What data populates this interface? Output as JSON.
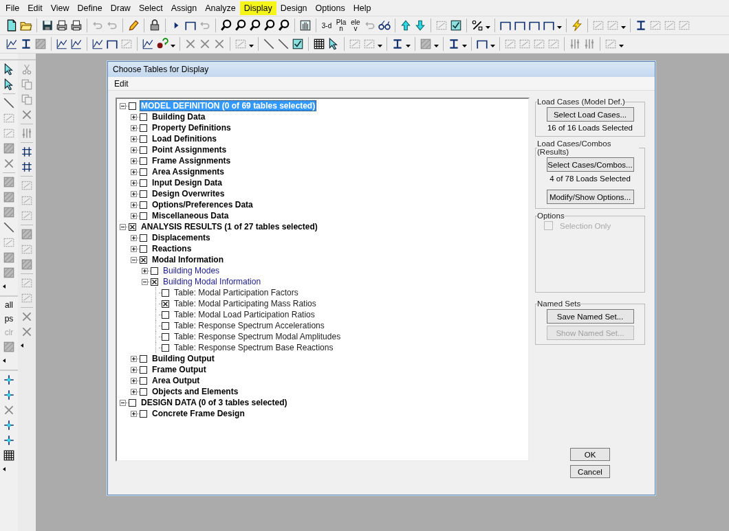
{
  "menu": [
    {
      "label": "File",
      "selected": false
    },
    {
      "label": "Edit",
      "selected": false
    },
    {
      "label": "View",
      "selected": false
    },
    {
      "label": "Define",
      "selected": false
    },
    {
      "label": "Draw",
      "selected": false
    },
    {
      "label": "Select",
      "selected": false
    },
    {
      "label": "Assign",
      "selected": false
    },
    {
      "label": "Analyze",
      "selected": false
    },
    {
      "label": "Display",
      "selected": true
    },
    {
      "label": "Design",
      "selected": false
    },
    {
      "label": "Options",
      "selected": false
    },
    {
      "label": "Help",
      "selected": false
    }
  ],
  "toolbar_labels": [
    "3-d",
    "Plan",
    "elev"
  ],
  "left_tool_labels": [
    {
      "label": "all",
      "disabled": false
    },
    {
      "label": "ps",
      "disabled": false
    },
    {
      "label": "clr",
      "disabled": true
    }
  ],
  "dialog": {
    "title": "Choose Tables for Display",
    "menu": [
      "Edit"
    ],
    "tree": [
      {
        "kind": "header",
        "label": "MODEL DEFINITION  (0 of 69 tables selected)",
        "checked": false,
        "expanded": true,
        "selected": true,
        "children": [
          {
            "kind": "group",
            "label": "Building Data",
            "checked": false,
            "expanded": false,
            "selected": false
          },
          {
            "kind": "group",
            "label": "Property Definitions",
            "checked": false,
            "expanded": false,
            "selected": false
          },
          {
            "kind": "group",
            "label": "Load Definitions",
            "checked": false,
            "expanded": false,
            "selected": false
          },
          {
            "kind": "group",
            "label": "Point Assignments",
            "checked": false,
            "expanded": false,
            "selected": false
          },
          {
            "kind": "group",
            "label": "Frame Assignments",
            "checked": false,
            "expanded": false,
            "selected": false
          },
          {
            "kind": "group",
            "label": "Area Assignments",
            "checked": false,
            "expanded": false,
            "selected": false
          },
          {
            "kind": "group",
            "label": "Input Design Data",
            "checked": false,
            "expanded": false,
            "selected": false
          },
          {
            "kind": "group",
            "label": "Design Overwrites",
            "checked": false,
            "expanded": false,
            "selected": false
          },
          {
            "kind": "group",
            "label": "Options/Preferences Data",
            "checked": false,
            "expanded": false,
            "selected": false
          },
          {
            "kind": "group",
            "label": "Miscellaneous Data",
            "checked": false,
            "expanded": false,
            "selected": false
          }
        ]
      },
      {
        "kind": "header",
        "label": "ANALYSIS RESULTS  (1 of 27 tables selected)",
        "checked": true,
        "expanded": true,
        "selected": false,
        "children": [
          {
            "kind": "group",
            "label": "Displacements",
            "checked": false,
            "expanded": false,
            "selected": false
          },
          {
            "kind": "group",
            "label": "Reactions",
            "checked": false,
            "expanded": false,
            "selected": false
          },
          {
            "kind": "group",
            "label": "Modal Information",
            "checked": true,
            "expanded": true,
            "selected": false,
            "children": [
              {
                "kind": "subgroup",
                "label": "Building Modes",
                "checked": false,
                "expanded": false,
                "selected": false
              },
              {
                "kind": "subgroup",
                "label": "Building Modal Information",
                "checked": true,
                "expanded": true,
                "selected": false,
                "children": [
                  {
                    "kind": "table",
                    "label": "Table:  Modal Participation Factors",
                    "checked": false,
                    "selected": false
                  },
                  {
                    "kind": "table",
                    "label": "Table:  Modal Participating Mass Ratios",
                    "checked": true,
                    "selected": false
                  },
                  {
                    "kind": "table",
                    "label": "Table:  Modal Load Participation Ratios",
                    "checked": false,
                    "selected": false
                  },
                  {
                    "kind": "table",
                    "label": "Table:  Response Spectrum Accelerations",
                    "checked": false,
                    "selected": false
                  },
                  {
                    "kind": "table",
                    "label": "Table:  Response Spectrum Modal Amplitudes",
                    "checked": false,
                    "selected": false
                  },
                  {
                    "kind": "table",
                    "label": "Table:  Response Spectrum Base Reactions",
                    "checked": false,
                    "selected": false
                  }
                ]
              }
            ]
          },
          {
            "kind": "group",
            "label": "Building Output",
            "checked": false,
            "expanded": false,
            "selected": false
          },
          {
            "kind": "group",
            "label": "Frame Output",
            "checked": false,
            "expanded": false,
            "selected": false
          },
          {
            "kind": "group",
            "label": "Area Output",
            "checked": false,
            "expanded": false,
            "selected": false
          },
          {
            "kind": "group",
            "label": "Objects and Elements",
            "checked": false,
            "expanded": false,
            "selected": false
          }
        ]
      },
      {
        "kind": "header",
        "label": "DESIGN DATA  (0 of 3 tables selected)",
        "checked": false,
        "expanded": true,
        "selected": false,
        "children": [
          {
            "kind": "group",
            "label": "Concrete Frame Design",
            "checked": false,
            "expanded": false,
            "selected": false
          }
        ]
      }
    ],
    "groups": [
      {
        "title": "Load Cases (Model Def.)",
        "items": [
          {
            "kind": "button",
            "label": "Select Load Cases...",
            "disabled": false
          },
          {
            "kind": "text",
            "text": "16  of  16  Loads Selected"
          }
        ]
      },
      {
        "title": "Load Cases/Combos (Results)",
        "items": [
          {
            "kind": "button",
            "label": "Select Cases/Combos...",
            "disabled": false
          },
          {
            "kind": "text",
            "text": "4  of  78  Loads Selected"
          },
          {
            "kind": "button",
            "label": "Modify/Show Options...",
            "disabled": false
          }
        ]
      },
      {
        "title": "Options",
        "items": [
          {
            "kind": "checkbox",
            "label": "Selection Only",
            "checked": false,
            "disabled": true
          }
        ]
      },
      {
        "title": "Named Sets",
        "items": [
          {
            "kind": "button",
            "label": "Save Named Set...",
            "disabled": false
          },
          {
            "kind": "button",
            "label": "Show Named Set...",
            "disabled": true
          }
        ]
      }
    ],
    "buttons": [
      "OK",
      "Cancel"
    ]
  }
}
